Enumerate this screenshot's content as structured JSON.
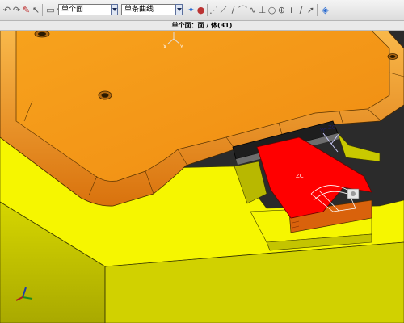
{
  "toolbar": {
    "filter_type": {
      "value": "单个面"
    },
    "curve_rule": {
      "value": "单条曲线"
    }
  },
  "status": {
    "text": "单个面：面 / 体(31)"
  },
  "viewport": {
    "labels": {
      "origin_z": "Z",
      "origin_x": "X",
      "origin_y": "Y",
      "csys_yc": "YC",
      "csys_zc": "ZC",
      "zc_red": "ZC"
    },
    "colors": {
      "cavity_plate": "#f6f600",
      "core_insert": "#f5a01c",
      "selected_face": "#ff0000",
      "background": "#2b2b2b"
    }
  },
  "icons": [
    "undo-icon",
    "redo-icon",
    "paint-icon",
    "select-icon",
    "snap-point-icon",
    "line-icon",
    "arc-icon",
    "point-icon",
    "circle-icon",
    "plus-icon",
    "slash-icon",
    "cursor-icon",
    "box-icon",
    "sphere-icon"
  ]
}
